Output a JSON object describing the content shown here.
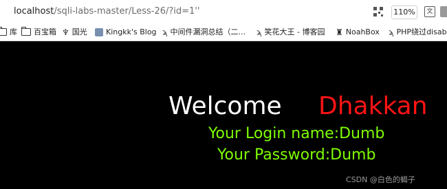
{
  "browser": {
    "url_host": "localhost",
    "url_path": "/sqli-labs-master/Less-26/?id=1''",
    "zoom": "110%",
    "icons": [
      "qr-code-icon",
      "translate-icon"
    ]
  },
  "bookmarks": [
    {
      "label": "库",
      "icon": "folder-icon"
    },
    {
      "label": "百宝箱",
      "icon": "folder-icon"
    },
    {
      "label": "国光",
      "icon": "gene-icon"
    },
    {
      "label": "Kingkk's Blog",
      "icon": "site-icon"
    },
    {
      "label": "中间件漏洞总结（二...",
      "icon": "site-icon"
    },
    {
      "label": "笑花大王 - 博客园",
      "icon": "site-icon"
    },
    {
      "label": "NoahBox",
      "icon": "site-icon"
    },
    {
      "label": "PHP绕过disab",
      "icon": "site-icon"
    }
  ],
  "page": {
    "welcome": "Welcome",
    "name": "Dhakkan",
    "login_line": "Your Login name:Dumb",
    "password_line": "Your Password:Dumb"
  },
  "watermark": "CSDN @白色的蝎子",
  "colors": {
    "background": "#000000",
    "welcome": "#ffffff",
    "dhakkan": "#ff1414",
    "info": "#7fff00"
  }
}
